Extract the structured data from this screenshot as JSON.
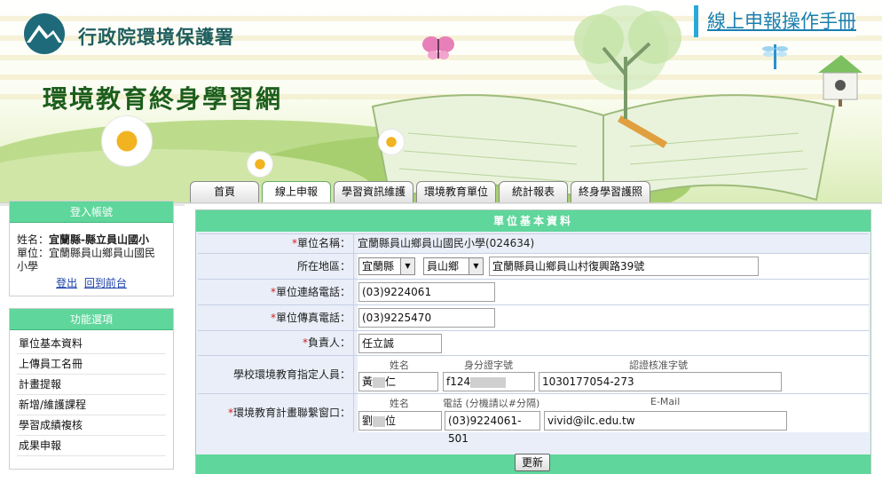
{
  "header": {
    "agency_name": "行政院環境保護署",
    "site_title": "環境教育終身學習網",
    "manual_link": "線上申報操作手冊"
  },
  "tabs": [
    {
      "label": "首頁"
    },
    {
      "label": "線上申報"
    },
    {
      "label": "學習資訊維護"
    },
    {
      "label": "環境教育單位"
    },
    {
      "label": "統計報表"
    },
    {
      "label": "終身學習護照"
    }
  ],
  "sidebar": {
    "login": {
      "title": "登入帳號",
      "name_label": "姓名：",
      "name_value": "宜蘭縣-縣立員山國小",
      "unit_label": "單位：",
      "unit_value": "宜蘭縣員山鄉員山國民小學",
      "logout": "登出",
      "back_to_frontend": "回到前台"
    },
    "functions": {
      "title": "功能選項",
      "items": [
        {
          "label": "單位基本資料"
        },
        {
          "label": "上傳員工名冊"
        },
        {
          "label": "計畫提報"
        },
        {
          "label": "新增/維護課程"
        },
        {
          "label": "學習成績複核"
        },
        {
          "label": "成果申報"
        }
      ]
    }
  },
  "form": {
    "title": "單位基本資料",
    "unit_name_label": "單位名稱：",
    "unit_name_value": "宜蘭縣員山鄉員山國民小學(024634)",
    "region_label": "所在地區：",
    "county": "宜蘭縣",
    "township": "員山鄉",
    "address": "宜蘭縣員山鄉員山村復興路39號",
    "phone_label": "單位連絡電話：",
    "phone": "(03)9224061",
    "fax_label": "單位傳真電話：",
    "fax": "(03)9225470",
    "owner_label": "負責人：",
    "owner": "任立誠",
    "designee_label": "學校環境教育指定人員：",
    "designee_headers": {
      "name": "姓名",
      "id": "身分證字號",
      "cert": "認證核准字號"
    },
    "designee": {
      "name_a": "黃",
      "name_b": "仁",
      "id": "f124",
      "cert": "1030177054-273"
    },
    "contact_label": "環境教育計畫聯繫窗口：",
    "contact_headers": {
      "name": "姓名",
      "phone": "電話 (分機請以#分隔)",
      "email": "E-Mail"
    },
    "contact": {
      "name_a": "劉",
      "name_b": "位",
      "phone": "(03)9224061-501",
      "email": "vivid@ilc.edu.tw"
    },
    "update_button": "更新",
    "required_mark": "*"
  },
  "colors": {
    "accent_green": "#5fd69b",
    "link_blue": "#1b3fa8",
    "form_bg": "#e9eef8"
  }
}
